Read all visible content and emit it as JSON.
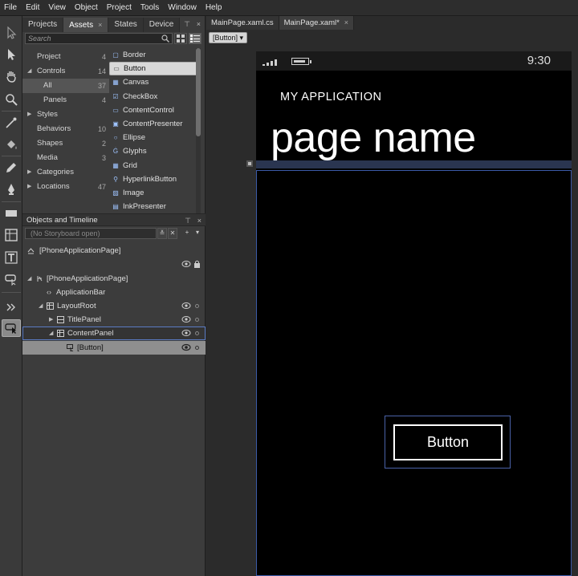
{
  "menu": [
    "File",
    "Edit",
    "View",
    "Object",
    "Project",
    "Tools",
    "Window",
    "Help"
  ],
  "panel_tabs": [
    {
      "label": "Projects"
    },
    {
      "label": "Assets",
      "close": "×"
    },
    {
      "label": "States"
    },
    {
      "label": "Device"
    }
  ],
  "search_placeholder": "Search",
  "categories": [
    {
      "label": "Project",
      "count": "4"
    },
    {
      "label": "Controls",
      "count": "14"
    },
    {
      "label": "All",
      "count": "37"
    },
    {
      "label": "Panels",
      "count": "4"
    },
    {
      "label": "Styles",
      "count": ""
    },
    {
      "label": "Behaviors",
      "count": "10"
    },
    {
      "label": "Shapes",
      "count": "2"
    },
    {
      "label": "Media",
      "count": "3"
    },
    {
      "label": "Categories",
      "count": ""
    },
    {
      "label": "Locations",
      "count": "47"
    }
  ],
  "assets": [
    "Border",
    "Button",
    "Canvas",
    "CheckBox",
    "ContentControl",
    "ContentPresenter",
    "Ellipse",
    "Glyphs",
    "Grid",
    "HyperlinkButton",
    "Image",
    "InkPresenter"
  ],
  "objects_timeline": {
    "title": "Objects and Timeline",
    "storyboard": "(No Storyboard open)",
    "nodes": [
      "[PhoneApplicationPage]",
      "[PhoneApplicationPage]",
      "ApplicationBar",
      "LayoutRoot",
      "TitlePanel",
      "ContentPanel",
      "[Button]"
    ]
  },
  "doc_tabs": [
    {
      "label": "MainPage.xaml.cs"
    },
    {
      "label": "MainPage.xaml*",
      "close": "×"
    }
  ],
  "breadcrumb": "[Button] ▾",
  "phone": {
    "clock": "9:30",
    "app_title": "MY APPLICATION",
    "page_name": "page name",
    "button_label": "Button"
  }
}
